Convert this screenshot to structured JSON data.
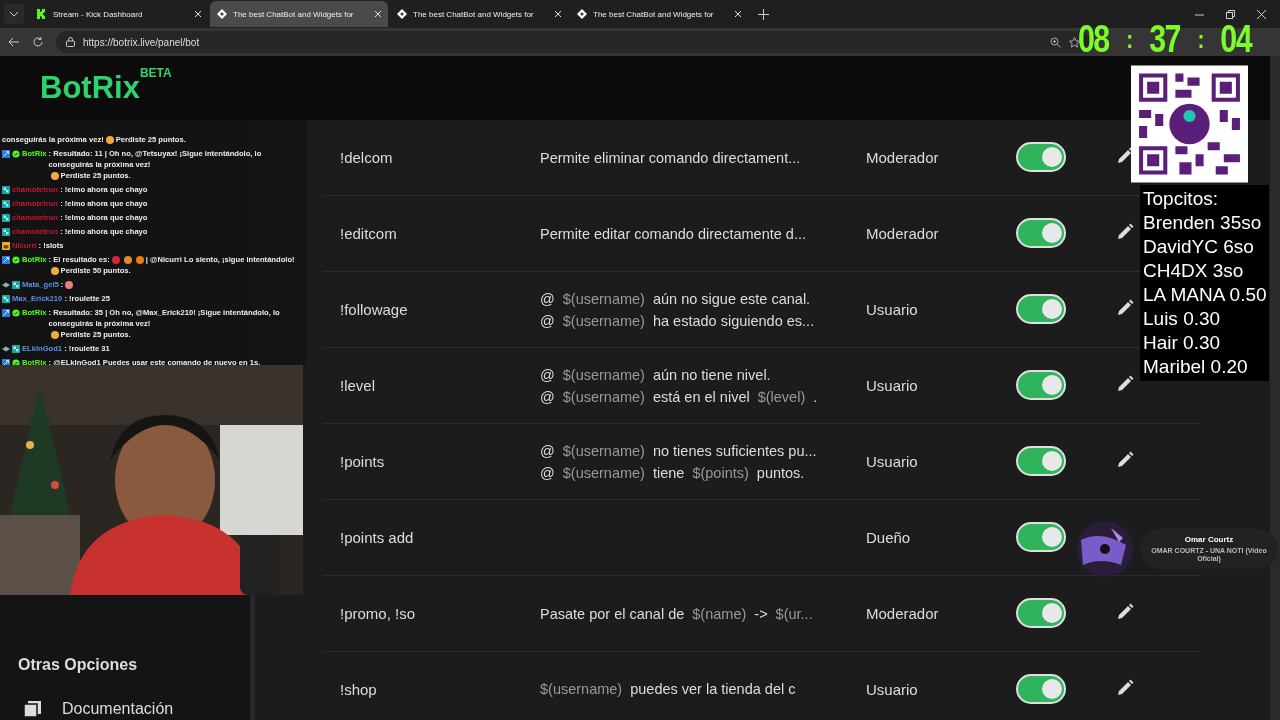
{
  "browser": {
    "tabs": [
      {
        "title": "Stream - Kick Dashboard",
        "selected": false
      },
      {
        "title": "The best ChatBot and Widgets for",
        "selected": true
      },
      {
        "title": "The best ChatBot and Widgets for",
        "selected": false
      },
      {
        "title": "The best ChatBot and Widgets for",
        "selected": false
      }
    ],
    "url": "https://botrix.live/panel/bot"
  },
  "app": {
    "logo": "BotRix",
    "badge": "BETA"
  },
  "sidebar": {
    "section": "Otras Opciones",
    "items": [
      {
        "label": "Documentación"
      }
    ]
  },
  "commands": [
    {
      "command": "!delcom",
      "lines": [
        [
          {
            "kind": "text",
            "text": "Permite eliminar comando directament..."
          }
        ]
      ],
      "role": "Moderador",
      "enabled": true,
      "editable": true
    },
    {
      "command": "!editcom",
      "lines": [
        [
          {
            "kind": "text",
            "text": "Permite editar comando directamente d..."
          }
        ]
      ],
      "role": "Moderador",
      "enabled": true,
      "editable": true
    },
    {
      "command": "!followage",
      "lines": [
        [
          {
            "kind": "text",
            "text": "@"
          },
          {
            "kind": "var",
            "text": "$(username)"
          },
          {
            "kind": "text",
            "text": "aún no sigue este canal."
          }
        ],
        [
          {
            "kind": "text",
            "text": "@"
          },
          {
            "kind": "var",
            "text": "$(username)"
          },
          {
            "kind": "text",
            "text": "ha estado siguiendo es..."
          }
        ]
      ],
      "role": "Usuario",
      "enabled": true,
      "editable": true
    },
    {
      "command": "!level",
      "lines": [
        [
          {
            "kind": "text",
            "text": "@"
          },
          {
            "kind": "var",
            "text": "$(username)"
          },
          {
            "kind": "text",
            "text": "aún no tiene nivel."
          }
        ],
        [
          {
            "kind": "text",
            "text": "@"
          },
          {
            "kind": "var",
            "text": "$(username)"
          },
          {
            "kind": "text",
            "text": "está en el nivel"
          },
          {
            "kind": "var",
            "text": "$(level)"
          },
          {
            "kind": "text",
            "text": "."
          }
        ]
      ],
      "role": "Usuario",
      "enabled": true,
      "editable": true
    },
    {
      "command": "!points",
      "lines": [
        [
          {
            "kind": "text",
            "text": "@"
          },
          {
            "kind": "var",
            "text": "$(username)"
          },
          {
            "kind": "text",
            "text": "no tienes suficientes pu..."
          }
        ],
        [
          {
            "kind": "text",
            "text": "@"
          },
          {
            "kind": "var",
            "text": "$(username)"
          },
          {
            "kind": "text",
            "text": "tiene"
          },
          {
            "kind": "var",
            "text": "$(points)"
          },
          {
            "kind": "text",
            "text": "puntos."
          }
        ]
      ],
      "role": "Usuario",
      "enabled": true,
      "editable": true
    },
    {
      "command": "!points add",
      "role": "Dueño",
      "enabled": true,
      "editable": false
    },
    {
      "command": "!promo, !so",
      "lines": [
        [
          {
            "kind": "text",
            "text": "Pasate por el canal de"
          },
          {
            "kind": "var",
            "text": "$(name)"
          },
          {
            "kind": "text",
            "text": "->"
          },
          {
            "kind": "var",
            "text": "$(ur..."
          }
        ]
      ],
      "role": "Moderador",
      "enabled": true,
      "editable": true
    },
    {
      "command": "!shop",
      "lines": [
        [
          {
            "kind": "var",
            "text": "$(username)"
          },
          {
            "kind": "text",
            "text": "puedes ver la tienda del c"
          }
        ]
      ],
      "role": "Usuario",
      "enabled": true,
      "editable": true
    }
  ],
  "chat": [
    {
      "kind": "continued",
      "parts": [
        {
          "kind": "text",
          "text": "conseguirás la próxima vez!"
        },
        {
          "kind": "emoji",
          "color": "#f2a93b"
        },
        {
          "kind": "text",
          "text": "Perdiste 25 puntos."
        }
      ]
    },
    {
      "kind": "bot",
      "user": "BotRix",
      "color": "#53fc18",
      "parts": [
        {
          "kind": "text",
          "text": ": Resultado: 11 | Oh no, @Tetsuyax! ¡Sigue intentándolo, lo conseguirás la próxima vez!"
        },
        {
          "kind": "emoji",
          "color": "#f2a93b"
        },
        {
          "kind": "text",
          "text": "Perdiste 25 puntos."
        }
      ]
    },
    {
      "kind": "subscriber",
      "user": "chamotetron",
      "color": "#c0182f",
      "parts": [
        {
          "kind": "text",
          "text": ": !elmo ahora que chayo"
        }
      ]
    },
    {
      "kind": "subscriber",
      "user": "chamotetron",
      "color": "#c0182f",
      "parts": [
        {
          "kind": "text",
          "text": ": !elmo ahora que chayo"
        }
      ]
    },
    {
      "kind": "subscriber",
      "user": "chamotetron",
      "color": "#c0182f",
      "parts": [
        {
          "kind": "text",
          "text": ": !elmo ahora que chayo"
        }
      ]
    },
    {
      "kind": "subscriber",
      "user": "chamotetron",
      "color": "#c0182f",
      "parts": [
        {
          "kind": "text",
          "text": ": !elmo ahora que chayo"
        }
      ]
    },
    {
      "kind": "gifter",
      "user": "Nicurri",
      "color": "#c0182f",
      "parts": [
        {
          "kind": "text",
          "text": ": !slots"
        }
      ]
    },
    {
      "kind": "bot",
      "user": "BotRix",
      "color": "#53fc18",
      "parts": [
        {
          "kind": "text",
          "text": ": El resultado es:"
        },
        {
          "kind": "emoji",
          "color": "#d8223a"
        },
        {
          "kind": "emoji",
          "color": "#e08a2c"
        },
        {
          "kind": "emoji",
          "color": "#f07a12"
        },
        {
          "kind": "text",
          "text": "| @Nicurri Lo siento, ¡sigue intentándolo!"
        },
        {
          "kind": "emoji",
          "color": "#f2a93b"
        },
        {
          "kind": "text",
          "text": "Perdiste 50 puntos."
        }
      ]
    },
    {
      "kind": "og",
      "user": "Mata_gel5",
      "color": "#5b8fe0",
      "parts": [
        {
          "kind": "text",
          "text": ":"
        },
        {
          "kind": "emoji",
          "color": "#e3807a"
        }
      ]
    },
    {
      "kind": "subscriber",
      "user": "Max_Erick210",
      "color": "#5b8fe0",
      "parts": [
        {
          "kind": "text",
          "text": ": !roulette 25"
        }
      ]
    },
    {
      "kind": "bot",
      "user": "BotRix",
      "color": "#53fc18",
      "parts": [
        {
          "kind": "text",
          "text": ": Resultado: 35 | Oh no, @Max_Erick210! ¡Sigue intentándolo, lo conseguirás la próxima vez!"
        },
        {
          "kind": "emoji",
          "color": "#f2a93b"
        },
        {
          "kind": "text",
          "text": "Perdiste 25 puntos."
        }
      ]
    },
    {
      "kind": "og",
      "user": "ELkInGod1",
      "color": "#5b8fe0",
      "parts": [
        {
          "kind": "text",
          "text": ": !roulette 31"
        }
      ]
    },
    {
      "kind": "bot",
      "user": "BotRix",
      "color": "#53fc18",
      "parts": [
        {
          "kind": "text",
          "text": ": @ELkInGod1 Puedes usar este comando de nuevo en 1s."
        }
      ]
    }
  ],
  "clock": {
    "hours": "08",
    "minutes": "37",
    "seconds": "04",
    "separator": ":"
  },
  "leaderboard": {
    "title": "Topcitos:",
    "entries": [
      "Brenden 35so",
      "DavidYC 6so",
      "CH4DX 3so",
      "LA MANA 0.50",
      "Luis 0.30",
      "Hair 0.30",
      "Maribel 0.20"
    ]
  },
  "now_playing": {
    "artist": "Omar Courtz",
    "title": "OMAR COURTZ - UNA NOTI (Video Oficial)"
  }
}
